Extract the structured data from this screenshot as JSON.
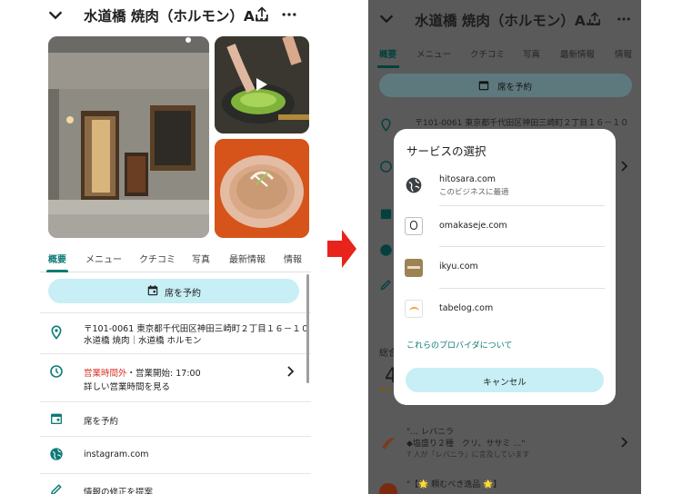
{
  "left": {
    "header": {
      "title": "水道橋 焼肉（ホルモン）A…"
    },
    "tabs": [
      "概要",
      "メニュー",
      "クチコミ",
      "写真",
      "最新情報",
      "情報"
    ],
    "reserve_label": "席を予約",
    "address": {
      "line1": "〒101-0061 東京都千代田区神田三崎町２丁目１６－１０",
      "line2": "水道橋 焼肉｜水道橋 ホルモン"
    },
    "hours": {
      "status": "営業時間外",
      "separator": "・",
      "open": "営業開始: 17:00",
      "more": "詳しい営業時間を見る"
    },
    "reserve_row": "席を予約",
    "website": "instagram.com",
    "suggest_edit": "情報の修正を提案"
  },
  "right": {
    "header": {
      "title": "水道橋 焼肉（ホルモン）A…"
    },
    "tabs": [
      "概要",
      "メニュー",
      "クチコミ",
      "写真",
      "最新情報",
      "情報"
    ],
    "reserve_label": "席を予約",
    "address": "〒101-0061 東京都千代田区神田三崎町２丁目１６－１０",
    "summary_label": "総合",
    "rating_digit": "4",
    "review1": {
      "line1": "\"… レバニラ",
      "line2": "◆塩盛り２種　クリ、ササミ …\"",
      "line3": "7 人が「レバニラ」に言及しています"
    },
    "review2": {
      "line1": "\"【🌟 頼むべき逸品 🌟】"
    },
    "dialog": {
      "title": "サービスの選択",
      "services": [
        {
          "name": "hitosara.com",
          "sub": "このビジネスに最適"
        },
        {
          "name": "omakaseje.com",
          "sub": ""
        },
        {
          "name": "ikyu.com",
          "sub": ""
        },
        {
          "name": "tabelog.com",
          "sub": ""
        }
      ],
      "about_link": "これらのプロバイダについて",
      "cancel": "キャンセル"
    }
  },
  "colors": {
    "accent": "#0b7a76",
    "pill": "#c7eff5",
    "closed_red": "#d93025",
    "arrow_red": "#e8231b"
  }
}
